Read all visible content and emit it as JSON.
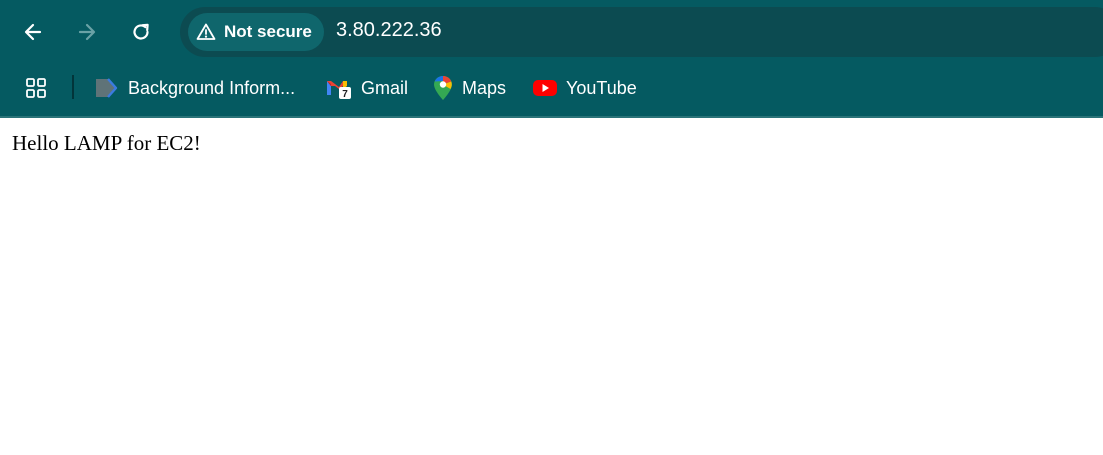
{
  "toolbar": {
    "back_icon": "arrow-left-icon",
    "forward_icon": "arrow-right-icon",
    "reload_icon": "reload-icon"
  },
  "omnibox": {
    "security_label": "Not secure",
    "security_icon": "warning-triangle-icon",
    "url": "3.80.222.36"
  },
  "bookmarks": {
    "apps_icon": "apps-grid-icon",
    "items": [
      {
        "label": "Background Inform...",
        "icon": "bookmark-doc-icon"
      },
      {
        "label": "Gmail",
        "icon": "gmail-icon"
      },
      {
        "label": "Maps",
        "icon": "maps-pin-icon"
      },
      {
        "label": "YouTube",
        "icon": "youtube-icon"
      }
    ]
  },
  "page": {
    "text": "Hello LAMP for EC2!"
  },
  "colors": {
    "chrome": "#055a61",
    "omnibox": "#0c4b51",
    "chip": "#0f666c"
  }
}
